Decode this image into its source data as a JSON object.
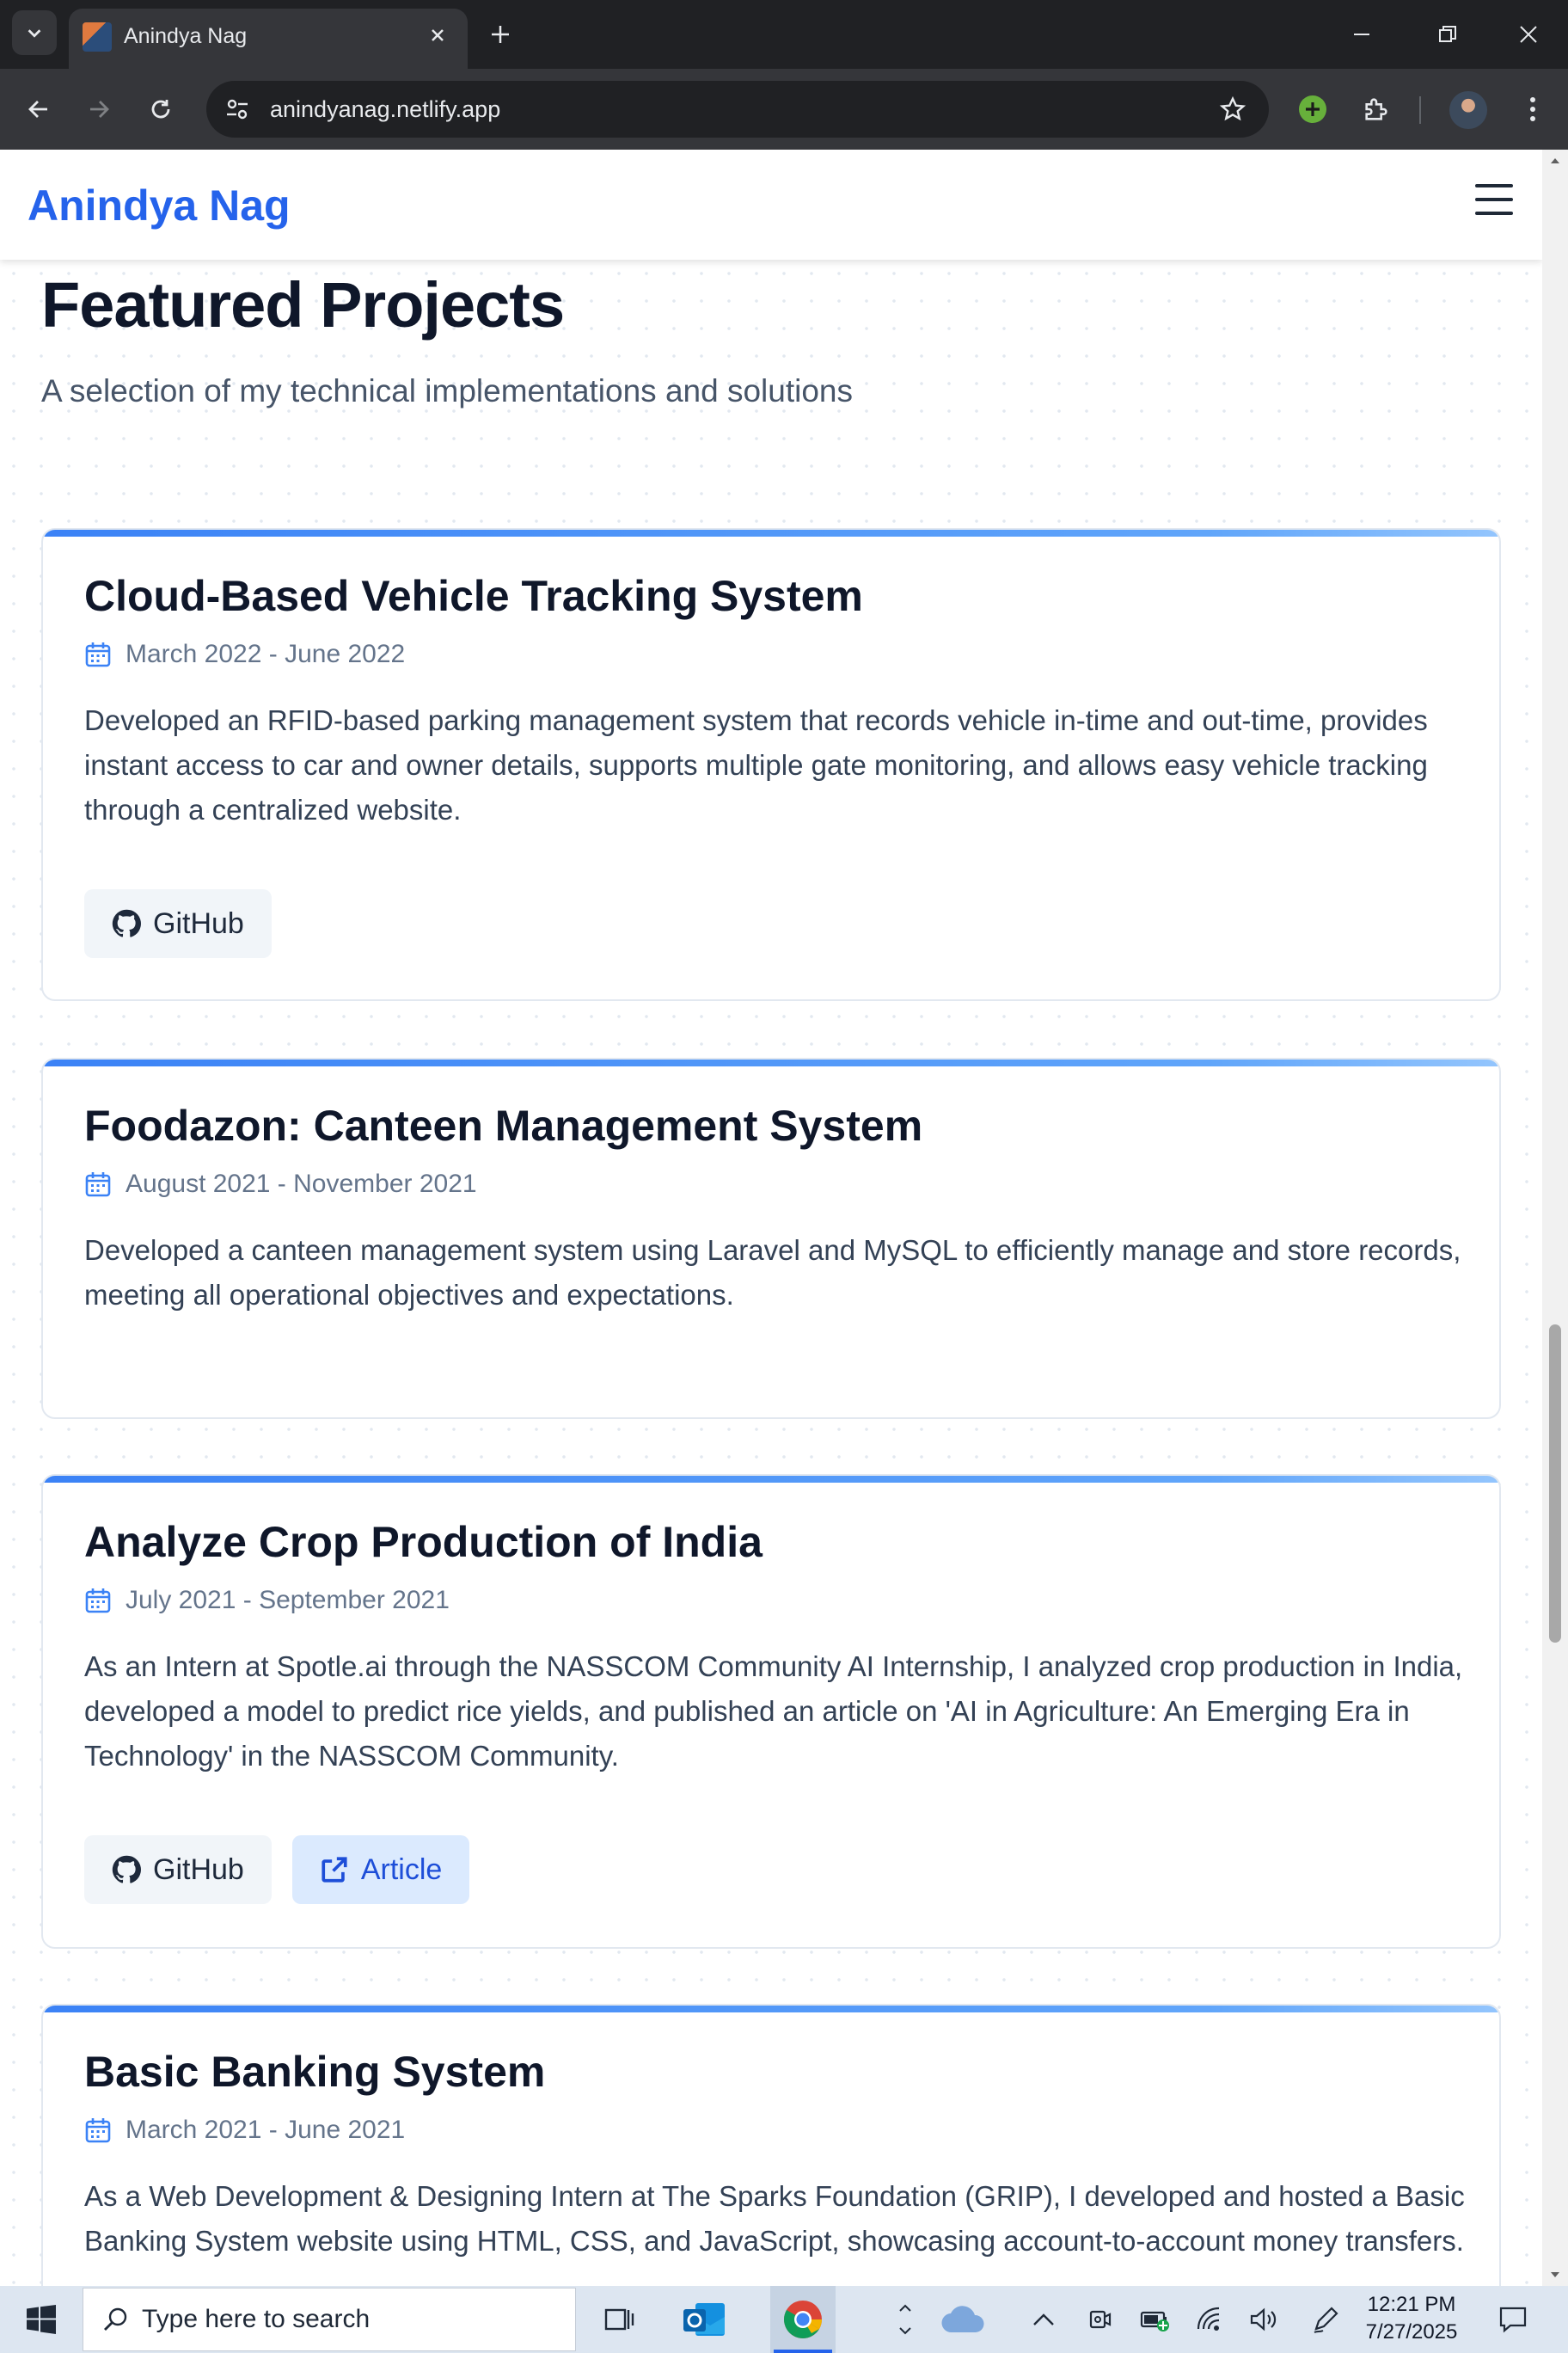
{
  "browser": {
    "tab_title": "Anindya Nag",
    "url": "anindyanag.netlify.app"
  },
  "site": {
    "brand": "Anindya Nag"
  },
  "section": {
    "title": "Featured Projects",
    "subtitle": "A selection of my technical implementations and solutions"
  },
  "projects": [
    {
      "title": "Cloud-Based Vehicle Tracking System",
      "date": "March 2022 - June 2022",
      "description": "Developed an RFID-based parking management system that records vehicle in-time and out-time, provides instant access to car and owner details, supports multiple gate monitoring, and allows easy vehicle tracking through a centralized website.",
      "github_label": "GitHub"
    },
    {
      "title": "Foodazon: Canteen Management System",
      "date": "August 2021 - November 2021",
      "description": "Developed a canteen management system using Laravel and MySQL to efficiently manage and store records, meeting all operational objectives and expectations."
    },
    {
      "title": "Analyze Crop Production of India",
      "date": "July 2021 - September 2021",
      "description": "As an Intern at Spotle.ai through the NASSCOM Community AI Internship, I analyzed crop production in India, developed a model to predict rice yields, and published an article on 'AI in Agriculture: An Emerging Era in Technology' in the NASSCOM Community.",
      "github_label": "GitHub",
      "article_label": "Article"
    },
    {
      "title": "Basic Banking System",
      "date": "March 2021 - June 2021",
      "description": "As a Web Development & Designing Intern at The Sparks Foundation (GRIP), I developed and hosted a Basic Banking System website using HTML, CSS, and JavaScript, showcasing account-to-account money transfers."
    }
  ],
  "taskbar": {
    "search_placeholder": "Type here to search",
    "time": "12:21 PM",
    "date": "7/27/2025"
  }
}
